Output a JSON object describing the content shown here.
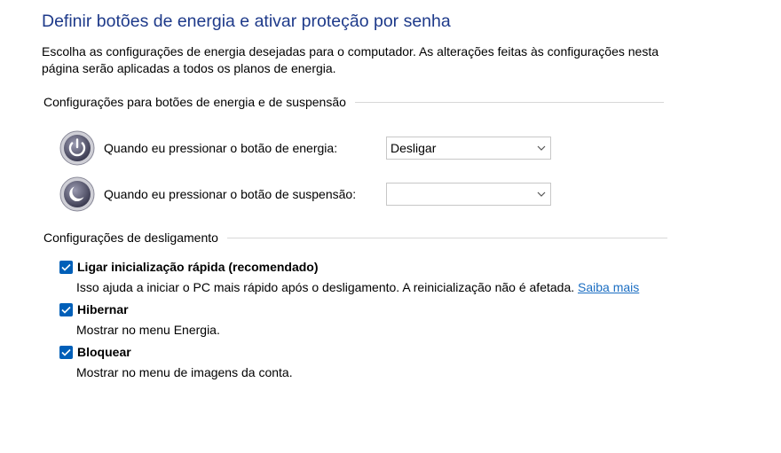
{
  "page": {
    "title": "Definir botões de energia e ativar proteção por senha",
    "intro": "Escolha as configurações de energia desejadas para o computador. As alterações feitas às configurações nesta página serão aplicadas a todos os planos de energia."
  },
  "power_buttons": {
    "header": "Configurações para botões de energia e de suspensão",
    "rows": [
      {
        "label": "Quando eu pressionar o botão de energia:",
        "value": "Desligar",
        "icon": "power-button-icon"
      },
      {
        "label": "Quando eu pressionar o botão de suspensão:",
        "value": "",
        "icon": "sleep-button-icon"
      }
    ]
  },
  "shutdown": {
    "header": "Configurações de desligamento",
    "options": [
      {
        "label": "Ligar inicialização rápida (recomendado)",
        "description": "Isso ajuda a iniciar o PC mais rápido após o desligamento. A reinicialização não é afetada.",
        "link": "Saiba mais",
        "checked": true
      },
      {
        "label": "Hibernar",
        "description": "Mostrar no menu Energia.",
        "checked": true
      },
      {
        "label": "Bloquear",
        "description": "Mostrar no menu de imagens da conta.",
        "checked": true
      }
    ]
  },
  "colors": {
    "title": "#1e3a8a",
    "checkbox": "#005fb8",
    "link": "#1b6ec2"
  }
}
